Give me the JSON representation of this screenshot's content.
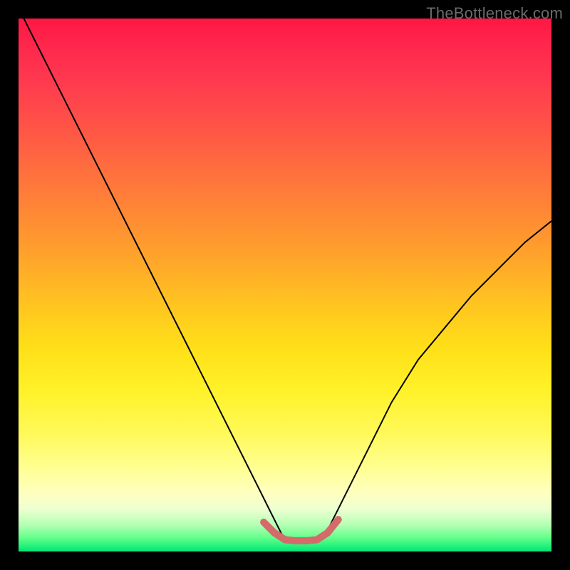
{
  "watermark": "TheBottleneck.com",
  "chart_data": {
    "type": "line",
    "title": "",
    "xlabel": "",
    "ylabel": "",
    "xlim": [
      0,
      100
    ],
    "ylim": [
      0,
      100
    ],
    "grid": false,
    "series": [
      {
        "name": "bottleneck-curve",
        "color": "#000000",
        "stroke_width": 2,
        "x": [
          0,
          5,
          10,
          15,
          20,
          25,
          30,
          35,
          40,
          45,
          48,
          50,
          52,
          54,
          56,
          58,
          60,
          65,
          70,
          75,
          80,
          85,
          90,
          95,
          100
        ],
        "y": [
          102,
          92,
          82,
          72,
          62,
          52,
          42,
          32,
          22,
          12,
          6,
          2,
          2,
          2,
          2,
          4,
          8,
          18,
          28,
          36,
          42,
          48,
          53,
          58,
          62
        ]
      },
      {
        "name": "optimal-band",
        "color": "#d46a6a",
        "stroke_width": 10,
        "x": [
          46,
          48,
          50,
          52,
          54,
          56,
          58,
          60
        ],
        "y": [
          5.5,
          3.5,
          2.2,
          2.0,
          2.0,
          2.2,
          3.5,
          6.0
        ]
      }
    ],
    "background_gradient": {
      "stops": [
        {
          "pos": 0.0,
          "color": "#ff1744"
        },
        {
          "pos": 0.5,
          "color": "#ffd21f"
        },
        {
          "pos": 0.78,
          "color": "#ffff70"
        },
        {
          "pos": 0.95,
          "color": "#9dff9d"
        },
        {
          "pos": 1.0,
          "color": "#00e676"
        }
      ]
    }
  }
}
